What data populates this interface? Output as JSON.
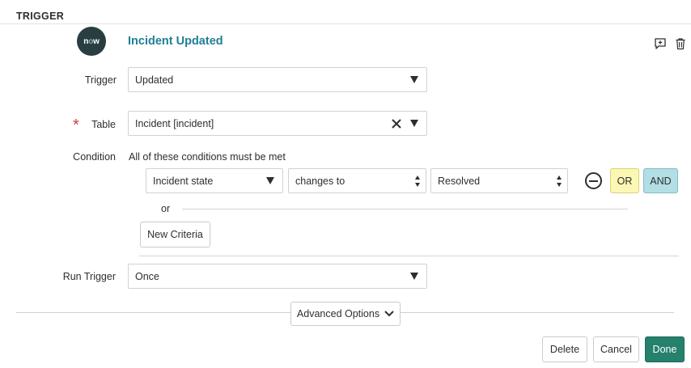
{
  "section": {
    "title": "TRIGGER"
  },
  "header": {
    "logo_text_n": "n",
    "logo_text_o": "o",
    "logo_text_w": "w",
    "title": "Incident Updated",
    "icons": [
      "add-comment-icon",
      "trash-icon"
    ]
  },
  "fields": {
    "trigger": {
      "label": "Trigger",
      "value": "Updated"
    },
    "table": {
      "label": "Table",
      "required_mark": "*",
      "value": "Incident [incident]"
    },
    "condition": {
      "label": "Condition",
      "description": "All of these conditions must be met",
      "row": {
        "field": "Incident state",
        "operator": "changes to",
        "value": "Resolved",
        "or_label": "OR",
        "and_label": "AND"
      },
      "or_separator": "or",
      "new_criteria_label": "New Criteria"
    },
    "run_trigger": {
      "label": "Run Trigger",
      "value": "Once"
    }
  },
  "advanced": {
    "label": "Advanced Options"
  },
  "footer": {
    "delete_label": "Delete",
    "cancel_label": "Cancel",
    "done_label": "Done"
  },
  "colors": {
    "accent_title": "#1f7f95",
    "or_bg": "#fcf8b4",
    "and_bg": "#b2dfe6",
    "done_bg": "#25806c",
    "required": "#d63a3a"
  }
}
